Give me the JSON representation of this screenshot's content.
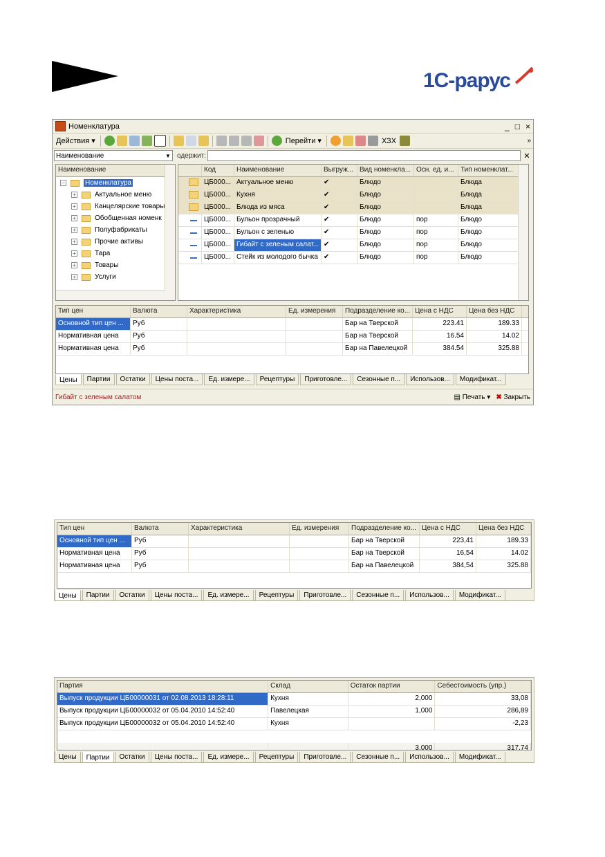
{
  "logo": {
    "text": "1С-рарус"
  },
  "window": {
    "title": "Номенклатура",
    "controls": [
      "_",
      "□",
      "×"
    ],
    "toolbar": {
      "actions_label": "Действия",
      "goto_label": "Перейти",
      "xsx_label": "ХЗХ"
    },
    "filter": {
      "combo_value": "Наименование",
      "contains_label": "одержит:"
    },
    "tree": {
      "header": "Наименование",
      "root": "Номенклатура",
      "items": [
        "Актуальное меню",
        "Канцелярские товары",
        "Обобщенная номенк",
        "Полуфабрикаты",
        "Прочие активы",
        "Тара",
        "Товары",
        "Услуги"
      ]
    },
    "list": {
      "headers": [
        "Код",
        "Наименование",
        "Выгруж...",
        "Вид номенкла...",
        "Осн. ед. и...",
        "Тип номенклат..."
      ],
      "rows": [
        {
          "code": "ЦБ000...",
          "name": "Актуальное меню",
          "flag": "✔",
          "kind": "Блюдо",
          "unit": "",
          "type": "Блюда",
          "group": true
        },
        {
          "code": "ЦБ000...",
          "name": "Кухня",
          "flag": "✔",
          "kind": "Блюдо",
          "unit": "",
          "type": "Блюда",
          "group": true
        },
        {
          "code": "ЦБ000...",
          "name": "Блюда из мяса",
          "flag": "✔",
          "kind": "Блюдо",
          "unit": "",
          "type": "Блюда",
          "group": true
        },
        {
          "code": "ЦБ000...",
          "name": "Бульон прозрачный",
          "flag": "✔",
          "kind": "Блюдо",
          "unit": "пор",
          "type": "Блюдо",
          "group": false
        },
        {
          "code": "ЦБ000...",
          "name": "Бульон с зеленью",
          "flag": "✔",
          "kind": "Блюдо",
          "unit": "пор",
          "type": "Блюдо",
          "group": false
        },
        {
          "code": "ЦБ000...",
          "name": "Гибайт с зеленым салат...",
          "flag": "✔",
          "kind": "Блюдо",
          "unit": "пор",
          "type": "Блюдо",
          "group": false
        },
        {
          "code": "ЦБ000...",
          "name": "Стейк из молодого бычка",
          "flag": "✔",
          "kind": "Блюдо",
          "unit": "пор",
          "type": "Блюдо",
          "group": false
        }
      ]
    },
    "prices": {
      "headers": [
        "Тип цен",
        "Валюта",
        "Характеристика",
        "Ед. измерения",
        "Подразделение ко...",
        "Цена с НДС",
        "Цена без НДС"
      ],
      "rows": [
        [
          "Основной тип цен ...",
          "Руб",
          "",
          "",
          "Бар на Тверской",
          "223.41",
          "189.33"
        ],
        [
          "Нормативная цена",
          "Руб",
          "",
          "",
          "Бар на Тверской",
          "16.54",
          "14.02"
        ],
        [
          "Нормативная цена",
          "Руб",
          "",
          "",
          "Бар на Павелецкой",
          "384.54",
          "325.88"
        ]
      ]
    },
    "tabs": [
      "Цены",
      "Партии",
      "Остатки",
      "Цены поста...",
      "Ед. измере...",
      "Рецептуры",
      "Приготовле...",
      "Сезонные п...",
      "Использов...",
      "Модификат..."
    ],
    "status": {
      "text": "Гибайт с зеленым салатом",
      "print_label": "Печать",
      "close_label": "Закрыть"
    }
  },
  "prices_panel": {
    "headers": [
      "Тип цен",
      "Валюта",
      "Характеристика",
      "Ед. измерения",
      "Подразделение ко...",
      "Цена с НДС",
      "Цена без НДС"
    ],
    "rows": [
      [
        "Основной тип цен ...",
        "Руб",
        "",
        "",
        "Бар на Тверской",
        "223,41",
        "189.33"
      ],
      [
        "Нормативная цена",
        "Руб",
        "",
        "",
        "Бар на Тверской",
        "16,54",
        "14.02"
      ],
      [
        "Нормативная цена",
        "Руб",
        "",
        "",
        "Бар на Павелецкой",
        "384,54",
        "325.88"
      ]
    ],
    "tabs": [
      "Цены",
      "Партии",
      "Остатки",
      "Цены поста...",
      "Ед. измере...",
      "Рецептуры",
      "Приготовле...",
      "Сезонные п...",
      "Использов...",
      "Модификат..."
    ]
  },
  "batches_panel": {
    "headers": [
      "Партия",
      "Склад",
      "Остаток партии",
      "Себестоимость (упр.)"
    ],
    "rows": [
      [
        "Выпуск продукции ЦБ00000031 от 02.08.2013 18:28:11",
        "Кухня",
        "2,000",
        "33,08"
      ],
      [
        "Выпуск продукции ЦБ00000032 от 05.04.2010 14:52:40",
        "Павелецкая",
        "1,000",
        "286,89"
      ],
      [
        "Выпуск продукции ЦБ00000032 от 05.04.2010 14:52:40",
        "Кухня",
        "",
        "-2,23"
      ]
    ],
    "totals": [
      "",
      "",
      "3,000",
      "317,74"
    ],
    "tabs": [
      "Цены",
      "Партии",
      "Остатки",
      "Цены поста...",
      "Ед. измере...",
      "Рецептуры",
      "Приготовле...",
      "Сезонные п...",
      "Использов...",
      "Модификат..."
    ]
  }
}
